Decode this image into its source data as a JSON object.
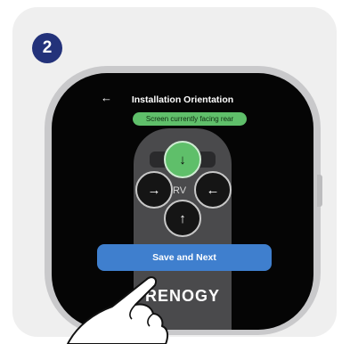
{
  "step_number": "2",
  "screen": {
    "title": "Installation Orientation",
    "back_icon": "back-arrow-icon",
    "status_pill": "Screen currently facing rear",
    "vehicle_label": "RV",
    "save_button": "Save and Next",
    "brand": "RENOGY"
  },
  "orientation_options": [
    {
      "id": "rear",
      "icon": "arrow-down-icon",
      "selected": true
    },
    {
      "id": "left",
      "icon": "arrow-right-icon",
      "selected": false
    },
    {
      "id": "right",
      "icon": "arrow-left-icon",
      "selected": false
    },
    {
      "id": "front",
      "icon": "arrow-up-icon",
      "selected": false
    }
  ],
  "colors": {
    "badge": "#23327a",
    "accent_green": "#5fbf6a",
    "button_blue": "#3f7fce"
  }
}
